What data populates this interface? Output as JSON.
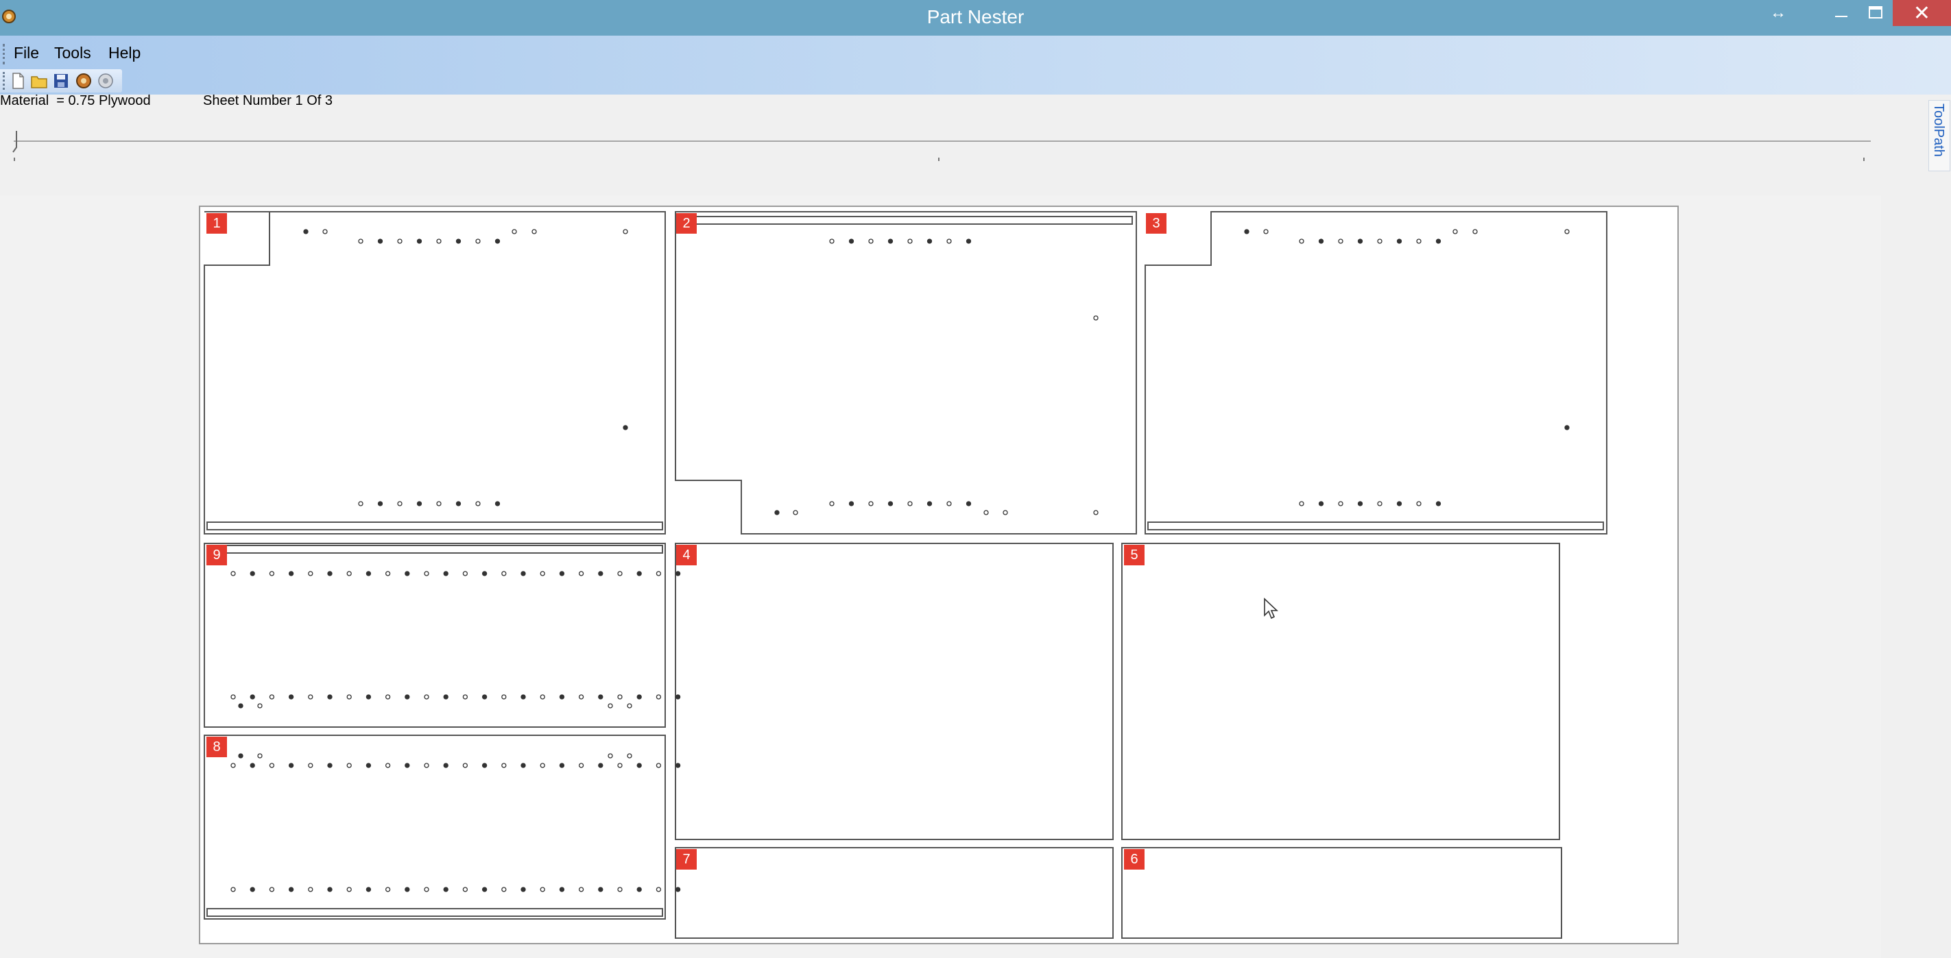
{
  "window": {
    "title": "Part Nester"
  },
  "menu": {
    "file": "File",
    "tools": "Tools",
    "help": "Help"
  },
  "toolbar_icons": [
    "new-file-icon",
    "open-folder-icon",
    "save-icon",
    "nest-icon",
    "settings-icon"
  ],
  "info": {
    "material": "Material  = 0.75 Plywood",
    "sheet": "Sheet Number 1 Of 3"
  },
  "side_tab": {
    "label": "ToolPath"
  },
  "parts": [
    "1",
    "2",
    "3",
    "9",
    "4",
    "5",
    "8",
    "7",
    "6"
  ],
  "colors": {
    "titlebar": "#6aa5c4",
    "close": "#c74b4b",
    "label": "#e53a2e",
    "side_tab_text": "#1f5fbf"
  }
}
